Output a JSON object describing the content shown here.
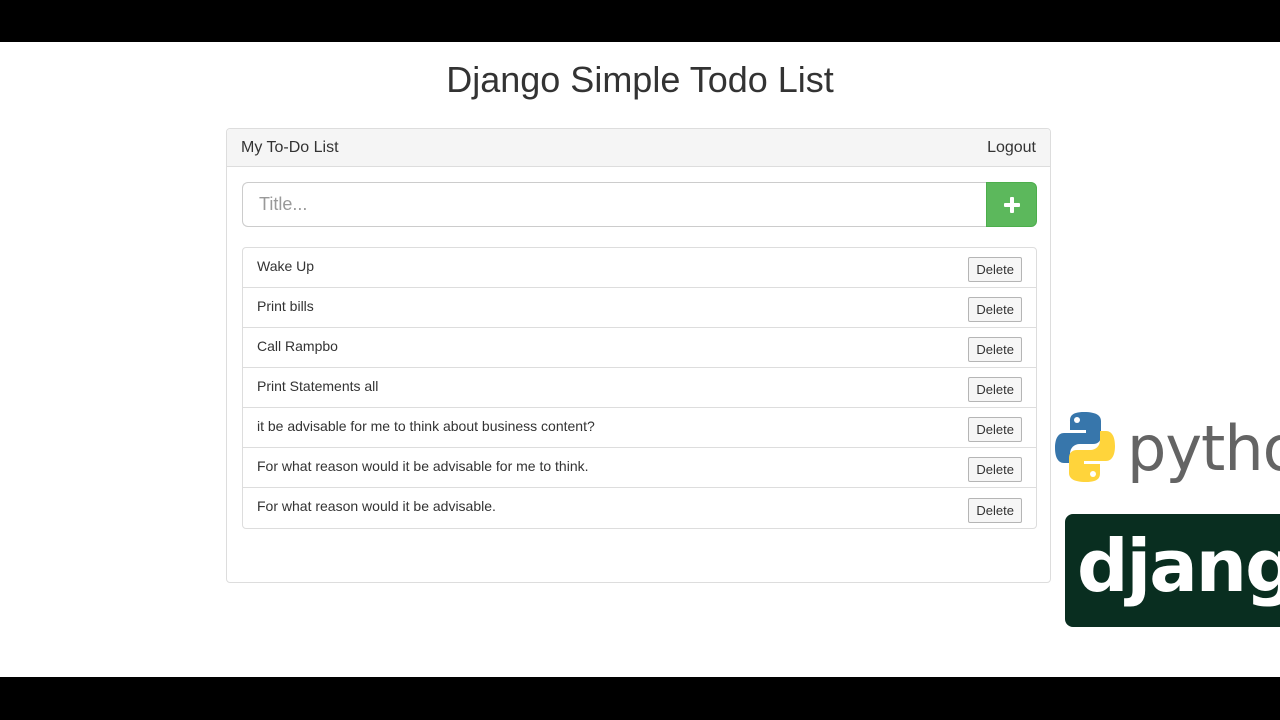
{
  "page": {
    "title": "Django Simple Todo List"
  },
  "panel": {
    "heading": "My To-Do List",
    "logout_label": "Logout"
  },
  "add_form": {
    "placeholder": "Title...",
    "value": "",
    "add_icon": "plus-icon"
  },
  "todos": [
    {
      "title": "Wake Up",
      "delete_label": "Delete"
    },
    {
      "title": "Print bills",
      "delete_label": "Delete"
    },
    {
      "title": "Call Rampbo",
      "delete_label": "Delete"
    },
    {
      "title": "Print Statements all",
      "delete_label": "Delete"
    },
    {
      "title": "it be advisable for me to think about business content?",
      "delete_label": "Delete"
    },
    {
      "title": "For what reason would it be advisable for me to think.",
      "delete_label": "Delete"
    },
    {
      "title": "For what reason would it be advisable.",
      "delete_label": "Delete"
    }
  ],
  "logos": {
    "python_text": "python",
    "django_text": "django"
  },
  "colors": {
    "add_button": "#5cb85c",
    "django_brand": "#092e20",
    "python_blue": "#3776ab",
    "python_yellow": "#ffd43b"
  }
}
